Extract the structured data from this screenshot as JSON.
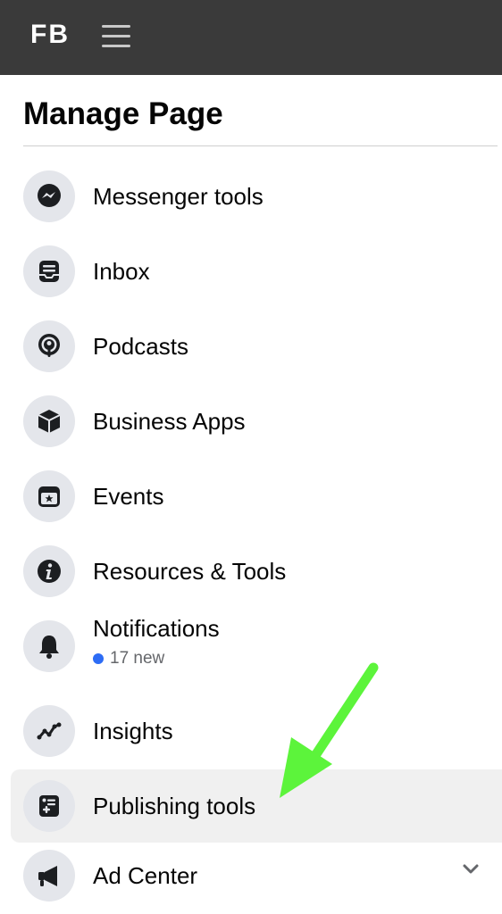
{
  "topbar": {
    "logo": "FB"
  },
  "page": {
    "title": "Manage Page"
  },
  "menu": {
    "items": [
      {
        "label": "Messenger tools",
        "icon": "messenger-icon"
      },
      {
        "label": "Inbox",
        "icon": "inbox-icon"
      },
      {
        "label": "Podcasts",
        "icon": "podcast-icon"
      },
      {
        "label": "Business Apps",
        "icon": "cube-icon"
      },
      {
        "label": "Events",
        "icon": "calendar-star-icon"
      },
      {
        "label": "Resources & Tools",
        "icon": "info-icon"
      },
      {
        "label": "Notifications",
        "icon": "bell-icon",
        "sub": "17 new"
      },
      {
        "label": "Insights",
        "icon": "insights-icon"
      },
      {
        "label": "Publishing tools",
        "icon": "publishing-icon",
        "active": true
      },
      {
        "label": "Ad Center",
        "icon": "megaphone-icon"
      }
    ]
  },
  "colors": {
    "topbar": "#3a3a3a",
    "badge_dot": "#2d6cf5",
    "arrow": "#5cf43b"
  }
}
